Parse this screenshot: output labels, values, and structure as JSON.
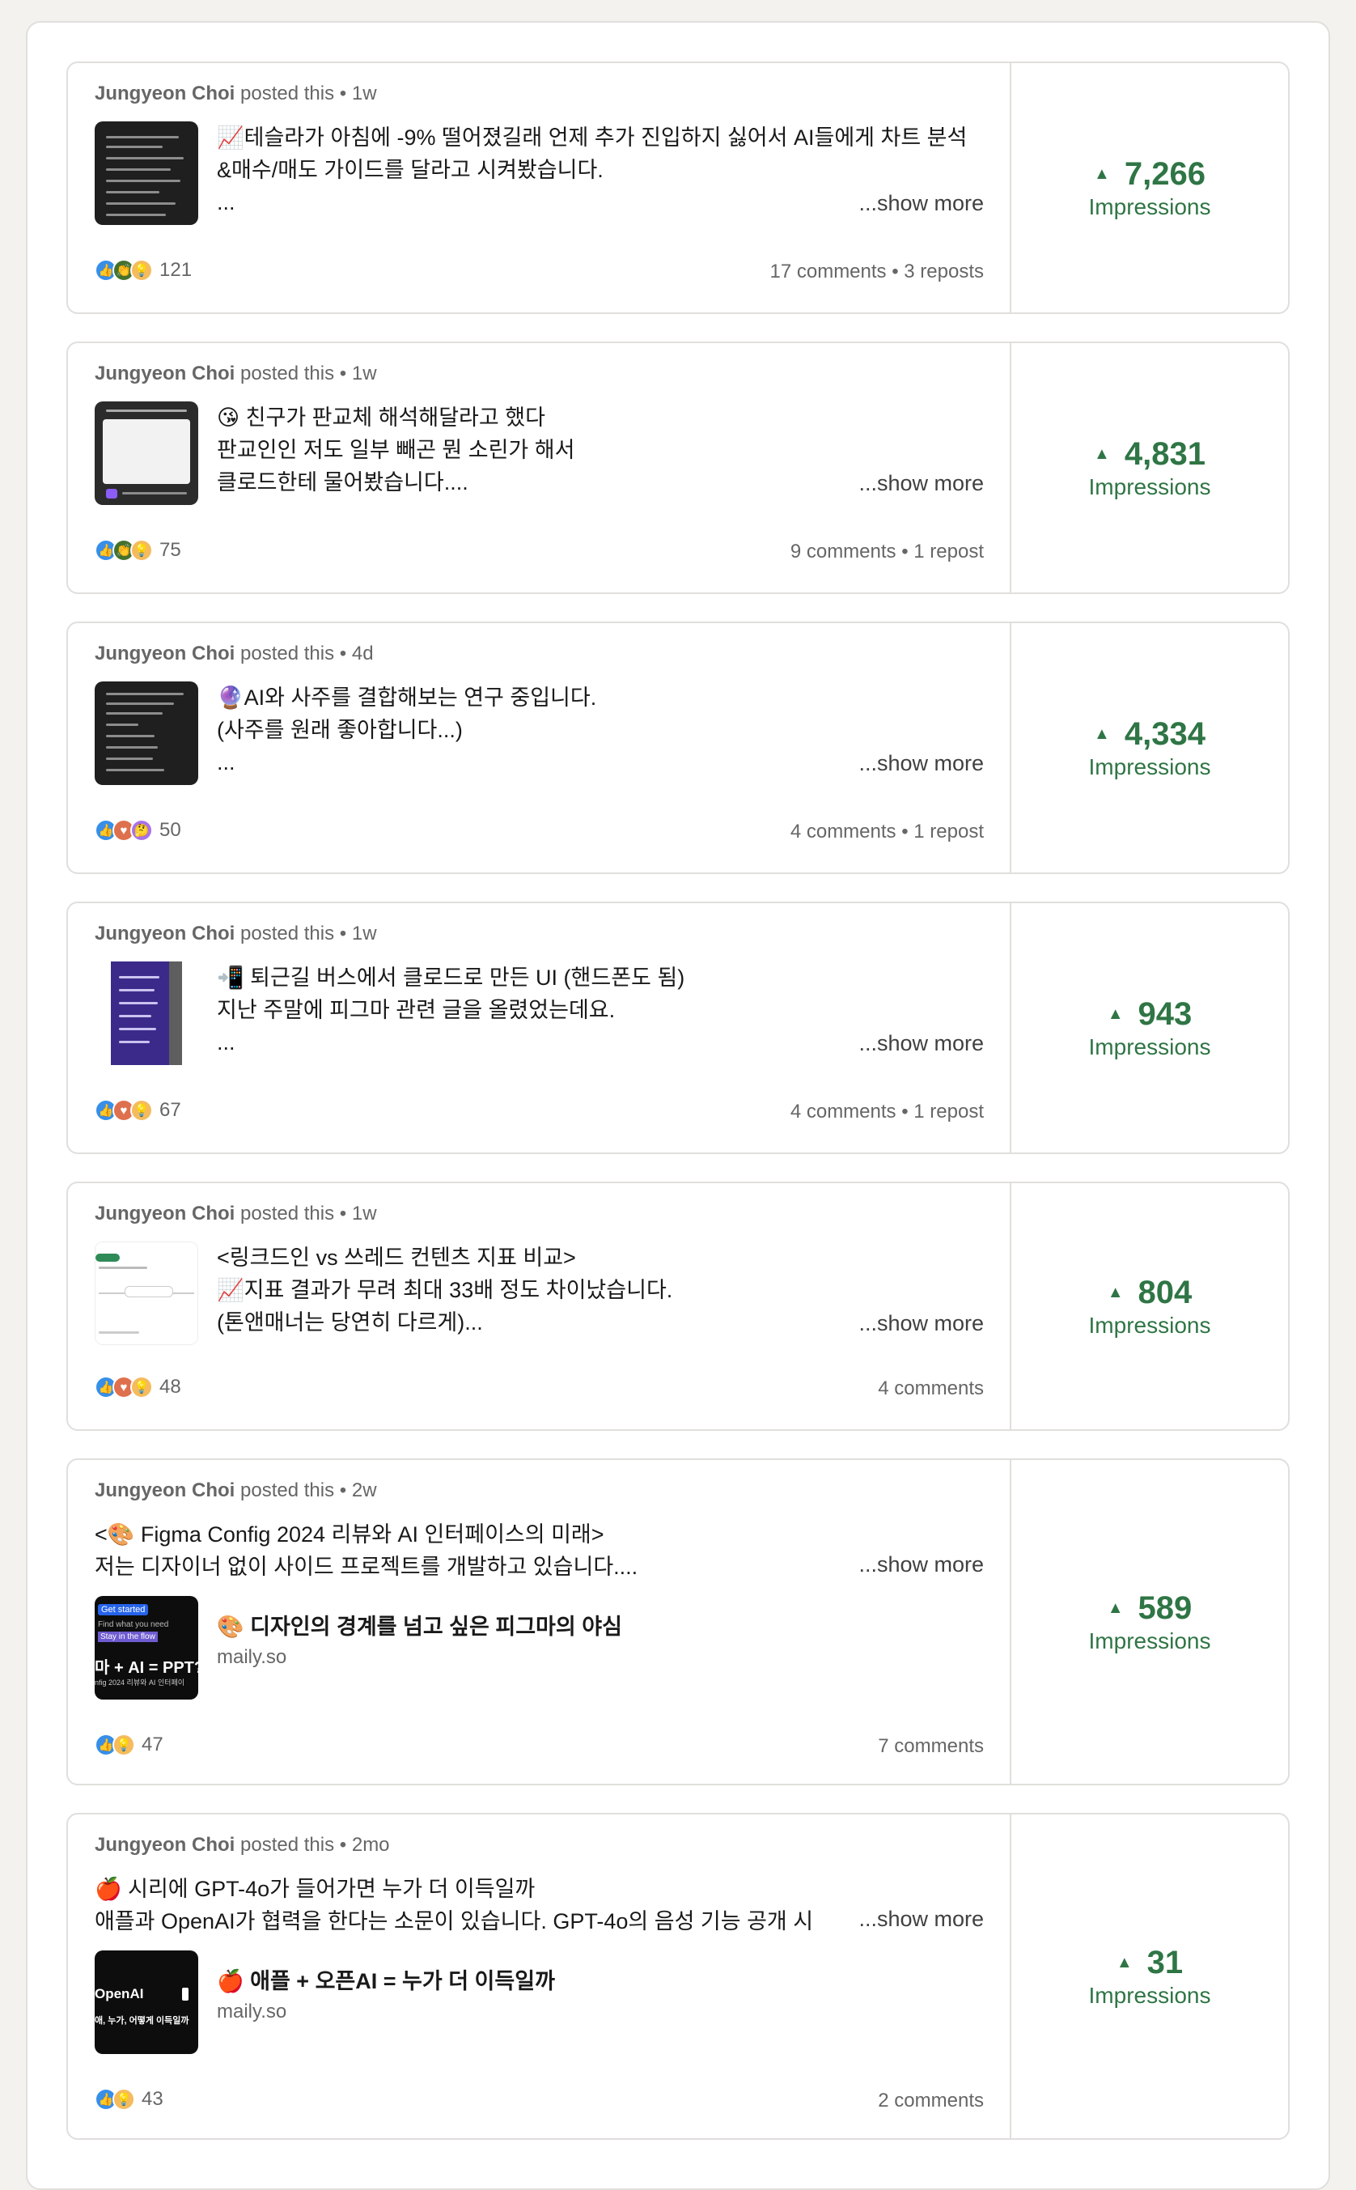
{
  "posts": [
    {
      "author": "Jungyeon Choi",
      "posted": "posted this",
      "age": "1w",
      "lines": [
        "📈테슬라가 아침에 -9% 떨어졌길래 언제 추가 진입하지 싫어서 AI들에게 차트 분석",
        "&매수/매도 가이드를 달라고 시켜봤습니다.",
        "..."
      ],
      "show_more": "...show more",
      "reactions": [
        "like",
        "celebrate",
        "insight"
      ],
      "reaction_count": "121",
      "meta": "17 comments • 3 reposts",
      "impressions": "7,266",
      "impressions_label": "Impressions"
    },
    {
      "author": "Jungyeon Choi",
      "posted": "posted this",
      "age": "1w",
      "lines": [
        "😘 친구가 판교체 해석해달라고 했다",
        "판교인인 저도 일부 빼곤 뭔 소린가 해서",
        "클로드한테 물어봤습니다...."
      ],
      "show_more": "...show more",
      "reactions": [
        "like",
        "celebrate",
        "insight"
      ],
      "reaction_count": "75",
      "meta": "9 comments • 1 repost",
      "impressions": "4,831",
      "impressions_label": "Impressions"
    },
    {
      "author": "Jungyeon Choi",
      "posted": "posted this",
      "age": "4d",
      "lines": [
        "🔮AI와 사주를 결합해보는 연구 중입니다.",
        "(사주를 원래 좋아합니다...)",
        "..."
      ],
      "show_more": "...show more",
      "reactions": [
        "like",
        "love",
        "curious"
      ],
      "reaction_count": "50",
      "meta": "4 comments • 1 repost",
      "impressions": "4,334",
      "impressions_label": "Impressions"
    },
    {
      "author": "Jungyeon Choi",
      "posted": "posted this",
      "age": "1w",
      "lines": [
        "📲 퇴근길 버스에서 클로드로 만든 UI (핸드폰도 됨)",
        "지난 주말에 피그마 관련 글을 올렸었는데요.",
        "..."
      ],
      "show_more": "...show more",
      "reactions": [
        "like",
        "love",
        "insight"
      ],
      "reaction_count": "67",
      "meta": "4 comments • 1 repost",
      "impressions": "943",
      "impressions_label": "Impressions"
    },
    {
      "author": "Jungyeon Choi",
      "posted": "posted this",
      "age": "1w",
      "lines": [
        "<링크드인 vs 쓰레드 컨텐츠 지표 비교>",
        "📈지표 결과가 무려 최대 33배 정도 차이났습니다.",
        "(톤앤매너는 당연히 다르게)..."
      ],
      "show_more": "...show more",
      "reactions": [
        "like",
        "love",
        "insight"
      ],
      "reaction_count": "48",
      "meta": "4 comments",
      "impressions": "804",
      "impressions_label": "Impressions"
    },
    {
      "author": "Jungyeon Choi",
      "posted": "posted this",
      "age": "2w",
      "lines": [
        "<🎨 Figma Config 2024 리뷰와 AI 인터페이스의 미래>",
        "저는 디자이너 없이 사이드 프로젝트를 개발하고 있습니다...."
      ],
      "show_more": "...show more",
      "link_title": "🎨 디자인의 경계를 넘고 싶은 피그마의 야심",
      "link_domain": "maily.so",
      "link_thumb_lines": [
        "Get started",
        "Find what you need",
        "Stay in the flow",
        "마 + AI = PPT?",
        "nfig 2024 리뷰와 AI 인터페이"
      ],
      "reactions": [
        "like",
        "insight"
      ],
      "reaction_count": "47",
      "meta": "7 comments",
      "impressions": "589",
      "impressions_label": "Impressions"
    },
    {
      "author": "Jungyeon Choi",
      "posted": "posted this",
      "age": "2mo",
      "lines": [
        "🍎 시리에 GPT-4o가 들어가면 누가 더 이득일까",
        "애플과 OpenAI가 협력을 한다는 소문이 있습니다. GPT-4o의 음성 기능 공개 시"
      ],
      "show_more": "...show more",
      "link_title": "🍎 애플 + 오픈AI = 누가 더 이득일까",
      "link_domain": "maily.so",
      "link_thumb_lines": [
        "OpenAI",
        "애, 누가, 어떻게 이득일까"
      ],
      "reactions": [
        "like",
        "insight"
      ],
      "reaction_count": "43",
      "meta": "2 comments",
      "impressions": "31",
      "impressions_label": "Impressions"
    }
  ],
  "icons": {
    "like": "thumbs-up-icon",
    "celebrate": "clapping-hands-icon",
    "insight": "lightbulb-icon",
    "love": "heart-icon",
    "curious": "thinking-icon",
    "up": "up-triangle-icon"
  },
  "colors": {
    "impressions_green": "#2f7545",
    "page_bg": "#f4f2ee",
    "border": "#e0dfdc"
  }
}
